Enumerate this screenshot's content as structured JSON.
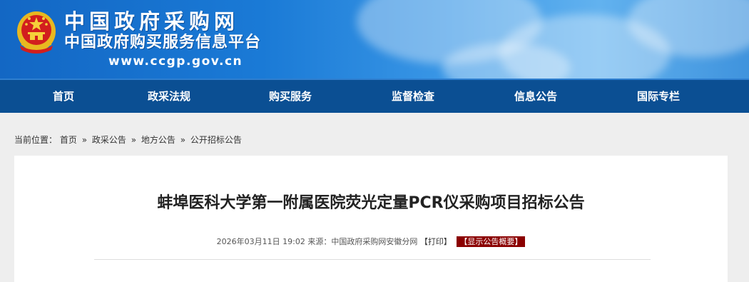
{
  "header": {
    "title": "中国政府采购网",
    "subtitle": "中国政府购买服务信息平台",
    "url": "www.ccgp.gov.cn"
  },
  "nav": {
    "items": [
      {
        "label": "首页"
      },
      {
        "label": "政采法规"
      },
      {
        "label": "购买服务"
      },
      {
        "label": "监督检查"
      },
      {
        "label": "信息公告"
      },
      {
        "label": "国际专栏"
      }
    ]
  },
  "breadcrumb": {
    "prefix": "当前位置：",
    "items": [
      "首页",
      "政采公告",
      "地方公告",
      "公开招标公告"
    ],
    "separator": "»"
  },
  "article": {
    "title": "蚌埠医科大学第一附属医院荧光定量PCR仪采购项目招标公告",
    "datetime": "2026年03月11日 19:02",
    "source_label": "来源：",
    "source": "中国政府采购网安徽分网",
    "print_label": "【打印】",
    "summary_button": "【显示公告概要】"
  },
  "colors": {
    "nav_bg": "#0b4f93",
    "banner_blue": "#1a7ad6",
    "summary_bg": "#8b0000"
  }
}
